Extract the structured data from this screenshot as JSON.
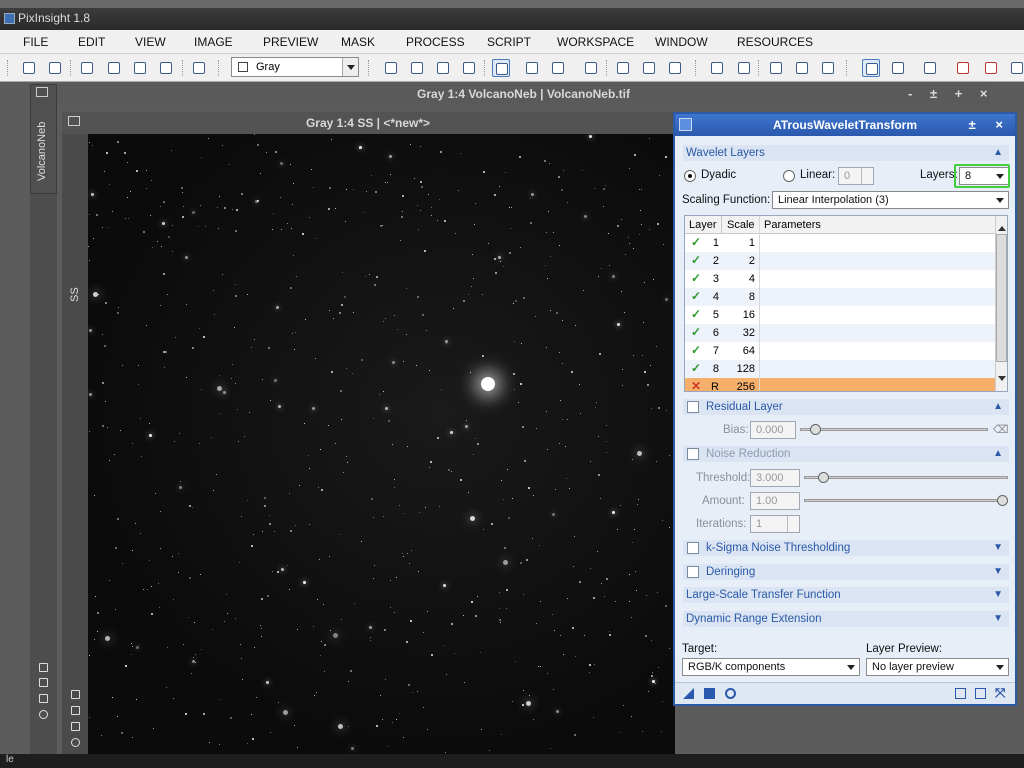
{
  "app": {
    "title": "PixInsight 1.8"
  },
  "menu": [
    "FILE",
    "EDIT",
    "VIEW",
    "IMAGE",
    "PREVIEW",
    "MASK",
    "PROCESS",
    "SCRIPT",
    "WORKSPACE",
    "WINDOW",
    "RESOURCES"
  ],
  "toolbar": {
    "colorspace_select": "Gray"
  },
  "windows": {
    "main": {
      "title": "Gray 1:4 VolcanoNeb | VolcanoNeb.tif",
      "side_tab": "VolcanoNeb",
      "controls": "- ± + ×"
    },
    "preview": {
      "title": "Gray 1:4 SS | <*new*>",
      "side_tab": "SS"
    }
  },
  "statusbar": {
    "text": "le"
  },
  "panel": {
    "title": "ATrousWaveletTransform",
    "title_controls": "± ×",
    "wavelet_layers": {
      "header": "Wavelet Layers",
      "dyadic_label": "Dyadic",
      "linear_label": "Linear:",
      "linear_value": "0",
      "layers_label": "Layers:",
      "layers_value": "8",
      "scaling_label": "Scaling Function:",
      "scaling_value": "Linear Interpolation (3)"
    },
    "table": {
      "columns": [
        "Layer",
        "Scale",
        "Parameters"
      ],
      "rows": [
        {
          "check": "✓",
          "layer": "1",
          "scale": "1",
          "params": ""
        },
        {
          "check": "✓",
          "layer": "2",
          "scale": "2",
          "params": ""
        },
        {
          "check": "✓",
          "layer": "3",
          "scale": "4",
          "params": ""
        },
        {
          "check": "✓",
          "layer": "4",
          "scale": "8",
          "params": ""
        },
        {
          "check": "✓",
          "layer": "5",
          "scale": "16",
          "params": ""
        },
        {
          "check": "✓",
          "layer": "6",
          "scale": "32",
          "params": ""
        },
        {
          "check": "✓",
          "layer": "7",
          "scale": "64",
          "params": ""
        },
        {
          "check": "✓",
          "layer": "8",
          "scale": "128",
          "params": ""
        },
        {
          "check": "✕",
          "layer": "R",
          "scale": "256",
          "params": ""
        }
      ]
    },
    "residual": {
      "header": "Residual Layer",
      "bias_label": "Bias:",
      "bias_value": "0.000"
    },
    "noise": {
      "header": "Noise Reduction",
      "threshold_label": "Threshold:",
      "threshold_value": "3.000",
      "amount_label": "Amount:",
      "amount_value": "1.00",
      "iterations_label": "Iterations:",
      "iterations_value": "1"
    },
    "ksigma": {
      "header": "k-Sigma Noise Thresholding"
    },
    "deringing": {
      "header": "Deringing"
    },
    "lstf": {
      "header": "Large-Scale Transfer Function"
    },
    "dre": {
      "header": "Dynamic Range Extension"
    },
    "target": {
      "label": "Target:",
      "value": "RGB/K components"
    },
    "layer_preview": {
      "label": "Layer Preview:",
      "value": "No layer preview"
    }
  },
  "colors": {
    "accent": "#2d5aa5",
    "highlight_row": "#f7b06b",
    "layers_box": "#3fcf3f",
    "check_green": "#2e9a2e",
    "cross_red": "#d03a2a"
  }
}
